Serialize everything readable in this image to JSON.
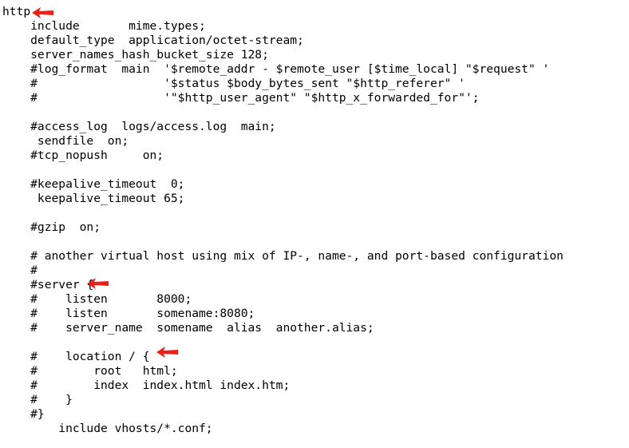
{
  "code": {
    "lines": [
      "http",
      "    include       mime.types;",
      "    default_type  application/octet-stream;",
      "    server_names_hash_bucket_size 128;",
      "    #log_format  main  '$remote_addr - $remote_user [$time_local] \"$request\" '",
      "    #                  '$status $body_bytes_sent \"$http_referer\" '",
      "    #                  '\"$http_user_agent\" \"$http_x_forwarded_for\"';",
      "",
      "    #access_log  logs/access.log  main;",
      "     sendfile  on;",
      "    #tcp_nopush     on;",
      "",
      "    #keepalive_timeout  0;",
      "     keepalive_timeout 65;",
      "",
      "    #gzip  on;",
      "",
      "    # another virtual host using mix of IP-, name-, and port-based configuration",
      "    #",
      "    #server {",
      "    #    listen       8000;",
      "    #    listen       somename:8080;",
      "    #    server_name  somename  alias  another.alias;",
      "",
      "    #    location / {",
      "    #        root   html;",
      "    #        index  index.html index.htm;",
      "    #    }",
      "    #}",
      "        include vhosts/*.conf;"
    ]
  },
  "annotations": {
    "arrow_color": "#e8211b",
    "arrow_icon": "red-arrow-left-icon"
  }
}
